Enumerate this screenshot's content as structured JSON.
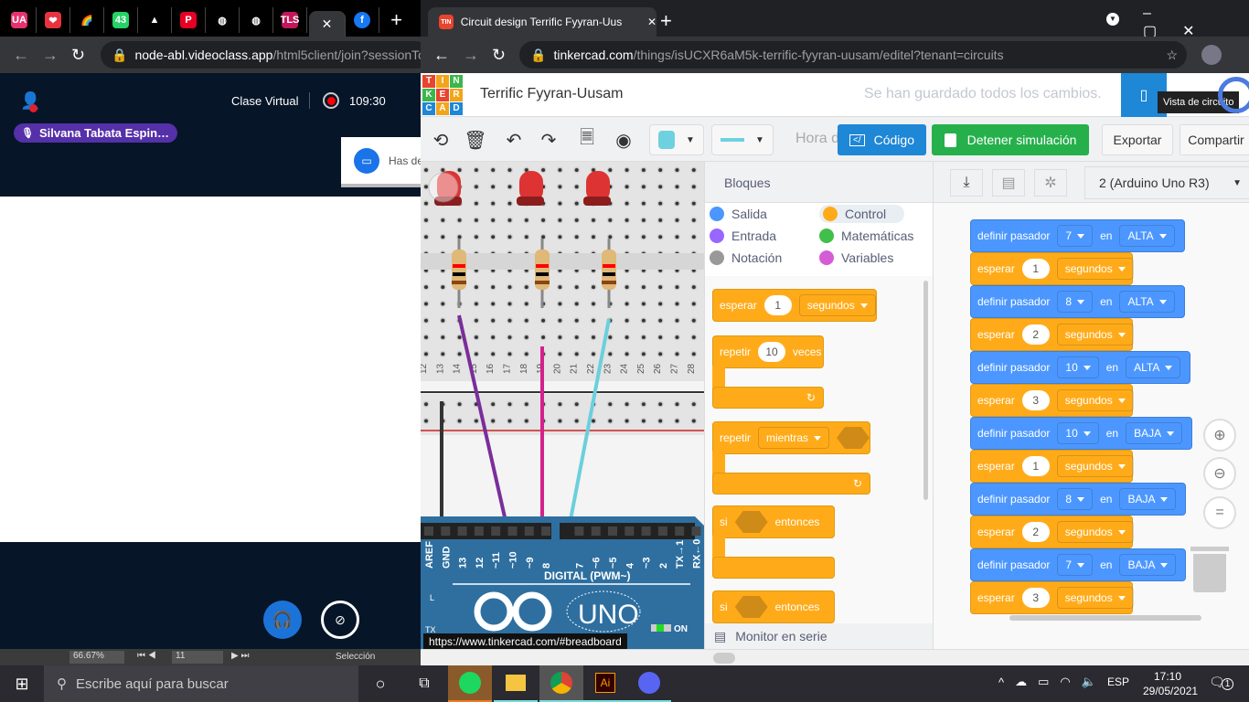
{
  "left_window": {
    "tabs": [
      {
        "icon": "ua-icon",
        "label": "UA",
        "color": "#e5336e"
      },
      {
        "icon": "heart-icon",
        "label": "❤",
        "color": "#e8333e"
      },
      {
        "icon": "rainbow-icon",
        "label": "🌈",
        "color": "transparent"
      },
      {
        "icon": "whatsapp-icon",
        "label": "43",
        "color": "#25d366"
      },
      {
        "icon": "drive-icon",
        "label": "▲",
        "color": "transparent"
      },
      {
        "icon": "pinterest-icon",
        "label": "P",
        "color": "#e60023"
      },
      {
        "icon": "globe-icon",
        "label": "◍",
        "color": "transparent"
      },
      {
        "icon": "globe-icon",
        "label": "◍",
        "color": "transparent"
      },
      {
        "icon": "tls-icon",
        "label": "TLS",
        "color": "#c2185b"
      }
    ],
    "active_tab_close": "✕",
    "facebook_label": "f",
    "new_tab": "+",
    "url_domain": "node-abl.videoclass.app",
    "url_path": "/html5client/join?sessionTo",
    "class_title": "Clase Virtual",
    "timer": "109:30",
    "presenter": "Silvana Tabata Espin…",
    "toast": "Has de",
    "statusbar": {
      "zoom": "66.67%",
      "page": "11",
      "mode": "Selección"
    }
  },
  "right_window": {
    "tab_title": "Circuit design Terrific Fyyran-Uus",
    "new_tab": "+",
    "url_domain": "tinkercad.com",
    "url_path": "/things/isUCXR6aM5k-terrific-fyyran-uusam/editel?tenant=circuits",
    "logo_letters": [
      "T",
      "I",
      "N",
      "K",
      "E",
      "R",
      "C",
      "A",
      "D"
    ],
    "logo_colors": [
      "#e8442e",
      "#f2a51a",
      "#3cb64b",
      "#3cb64b",
      "#e8442e",
      "#f2a51a",
      "#1e87d6",
      "#f2a51a",
      "#1e87d6"
    ],
    "project_name": "Terrific Fyyran-Uusam",
    "save_status": "Se han guardado todos los cambios.",
    "tooltip": "Vista de circuito",
    "toolbar": {
      "time_label": "Hora d",
      "code_btn": "Código",
      "stop_btn": "Detener simulación",
      "export": "Exportar",
      "share": "Compartir",
      "fill_color": "#6fd0e0"
    },
    "link_tooltip": "https://www.tinkercad.com/#breadboard",
    "breadboard": {
      "columns": [
        "12",
        "13",
        "14",
        "15",
        "16",
        "17",
        "18",
        "19",
        "20",
        "21",
        "22",
        "23",
        "24",
        "25",
        "26",
        "27",
        "28"
      ],
      "pins": [
        "AREF",
        "GND",
        "13",
        "12",
        "~11",
        "~10",
        "~9",
        "8",
        "7",
        "~6",
        "~5",
        "4",
        "~3",
        "2",
        "TX→1",
        "RX←0"
      ],
      "digital_label": "DIGITAL (PWM~)",
      "board_name": "UNO",
      "on_label": "ON",
      "l_label": "L",
      "tx_label": "TX"
    },
    "blocks_panel": {
      "title": "Bloques",
      "categories": [
        {
          "label": "Salida",
          "color": "#4c97ff"
        },
        {
          "label": "Control",
          "color": "#ffab19"
        },
        {
          "label": "Entrada",
          "color": "#9966ff"
        },
        {
          "label": "Matemáticas",
          "color": "#40bf4a"
        },
        {
          "label": "Notación",
          "color": "#999999"
        },
        {
          "label": "Variables",
          "color": "#d65cd6"
        }
      ],
      "wait": {
        "label": "esperar",
        "value": "1",
        "unit": "segundos"
      },
      "repeat": {
        "label": "repetir",
        "value": "10",
        "suffix": "veces"
      },
      "repeat_while": {
        "label": "repetir",
        "mode": "mientras"
      },
      "if1": {
        "label": "si",
        "suffix": "entonces"
      },
      "if2": {
        "label": "si",
        "suffix": "entonces"
      },
      "serial_monitor": "Monitor en serie"
    },
    "code_panel": {
      "board_select": "2 (Arduino Uno R3)",
      "code": [
        {
          "type": "set",
          "label": "definir pasador",
          "pin": "7",
          "en": "en",
          "state": "ALTA"
        },
        {
          "type": "wait",
          "label": "esperar",
          "value": "1",
          "unit": "segundos"
        },
        {
          "type": "set",
          "label": "definir pasador",
          "pin": "8",
          "en": "en",
          "state": "ALTA"
        },
        {
          "type": "wait",
          "label": "esperar",
          "value": "2",
          "unit": "segundos"
        },
        {
          "type": "set",
          "label": "definir pasador",
          "pin": "10",
          "en": "en",
          "state": "ALTA"
        },
        {
          "type": "wait",
          "label": "esperar",
          "value": "3",
          "unit": "segundos"
        },
        {
          "type": "set",
          "label": "definir pasador",
          "pin": "10",
          "en": "en",
          "state": "BAJA"
        },
        {
          "type": "wait",
          "label": "esperar",
          "value": "1",
          "unit": "segundos"
        },
        {
          "type": "set",
          "label": "definir pasador",
          "pin": "8",
          "en": "en",
          "state": "BAJA"
        },
        {
          "type": "wait",
          "label": "esperar",
          "value": "2",
          "unit": "segundos"
        },
        {
          "type": "set",
          "label": "definir pasador",
          "pin": "7",
          "en": "en",
          "state": "BAJA"
        },
        {
          "type": "wait",
          "label": "esperar",
          "value": "3",
          "unit": "segundos"
        }
      ]
    }
  },
  "taskbar": {
    "search_placeholder": "Escribe aquí para buscar",
    "apps": [
      "spotify",
      "file-explorer",
      "chrome",
      "illustrator",
      "discord"
    ],
    "ai_label": "Ai",
    "language": "ESP",
    "time": "17:10",
    "date": "29/05/2021",
    "notifications": "1"
  }
}
